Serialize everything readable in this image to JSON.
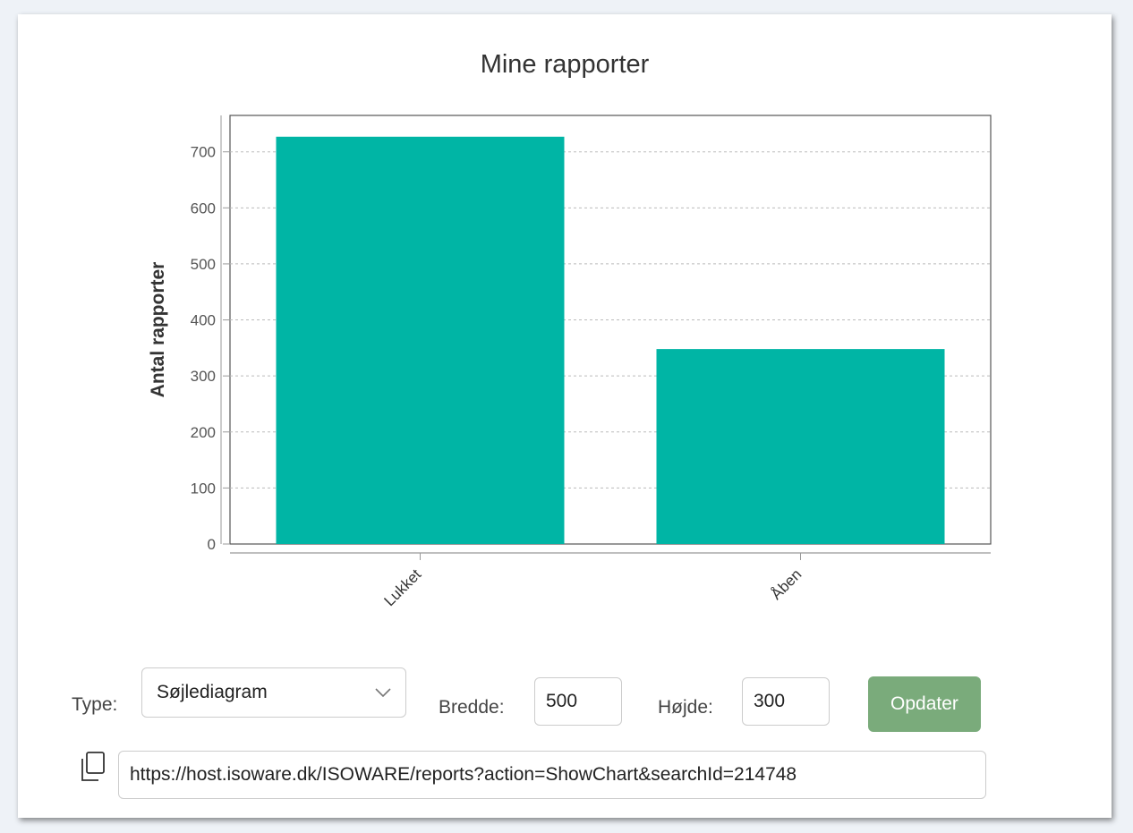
{
  "colors": {
    "bar": "#00b5a5",
    "button": "#7aab7b"
  },
  "chart_data": {
    "type": "bar",
    "title": "Mine rapporter",
    "xlabel": "",
    "ylabel": "Antal rapporter",
    "categories": [
      "Lukket",
      "Åben"
    ],
    "values": [
      727,
      348
    ],
    "ylim": [
      0,
      765
    ],
    "yticks": [
      0,
      100,
      200,
      300,
      400,
      500,
      600,
      700
    ],
    "grid": true,
    "legend": "none"
  },
  "controls": {
    "type_label": "Type:",
    "type_value": "Søjlediagram",
    "width_label": "Bredde:",
    "width_value": "500",
    "height_label": "Højde:",
    "height_value": "300",
    "update_label": "Opdater"
  },
  "url": {
    "icon": "copy-icon",
    "value": "https://host.isoware.dk/ISOWARE/reports?action=ShowChart&searchId=214748"
  }
}
